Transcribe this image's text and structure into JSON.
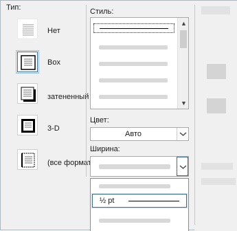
{
  "setting": {
    "title": "Тип:",
    "items": [
      {
        "label": "Нет",
        "icon": "border-none-icon"
      },
      {
        "label": "Box",
        "icon": "border-box-icon"
      },
      {
        "label": "затененный",
        "icon": "border-shadow-icon"
      },
      {
        "label": "3-D",
        "icon": "border-3d-icon"
      },
      {
        "label": "(все форматы)",
        "icon": "border-custom-icon"
      }
    ]
  },
  "style": {
    "title": "Стиль:"
  },
  "color": {
    "title": "Цвет:",
    "value": "Авто"
  },
  "width": {
    "title": "Ширина:",
    "selected_option": "½ pt"
  },
  "colors": {
    "selection": "#3a6ea5",
    "dialog_bg": "#f0f0f0"
  }
}
